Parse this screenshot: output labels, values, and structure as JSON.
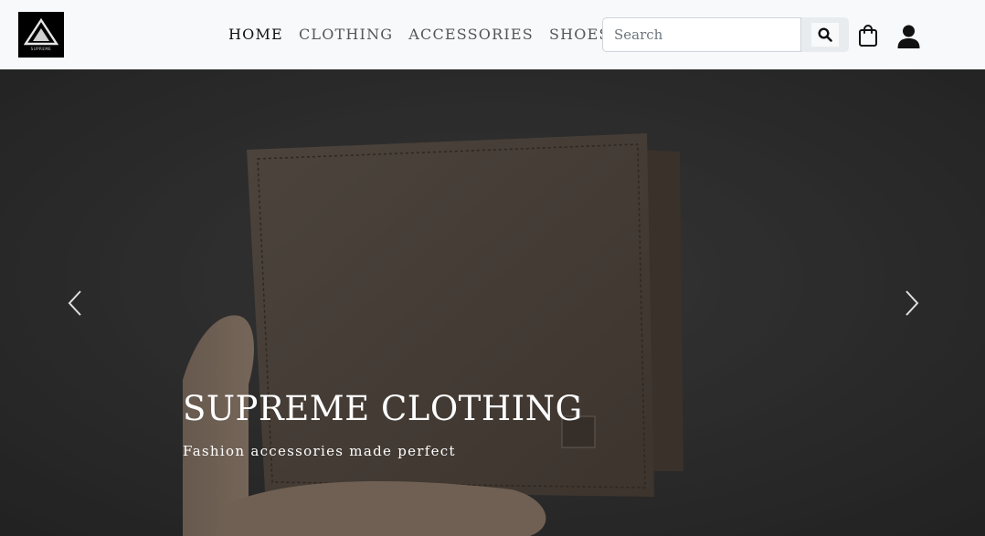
{
  "brand": {
    "logo_text": "SUPREME"
  },
  "nav": {
    "items": [
      {
        "label": "HOME",
        "active": true
      },
      {
        "label": "CLOTHING",
        "active": false
      },
      {
        "label": "ACCESSORIES",
        "active": false
      },
      {
        "label": "SHOES",
        "active": false
      }
    ]
  },
  "search": {
    "placeholder": "Search",
    "value": ""
  },
  "icons": {
    "search": "search-icon",
    "cart": "shopping-bag-icon",
    "user": "user-icon",
    "prev": "chevron-left-icon",
    "next": "chevron-right-icon"
  },
  "hero": {
    "title": "SUPREME CLOTHING",
    "subtitle": "Fashion accessories made perfect"
  },
  "colors": {
    "navbar_bg": "#f8f9fa",
    "hero_overlay": "#3a3a3a",
    "text_light": "#ffffff"
  }
}
